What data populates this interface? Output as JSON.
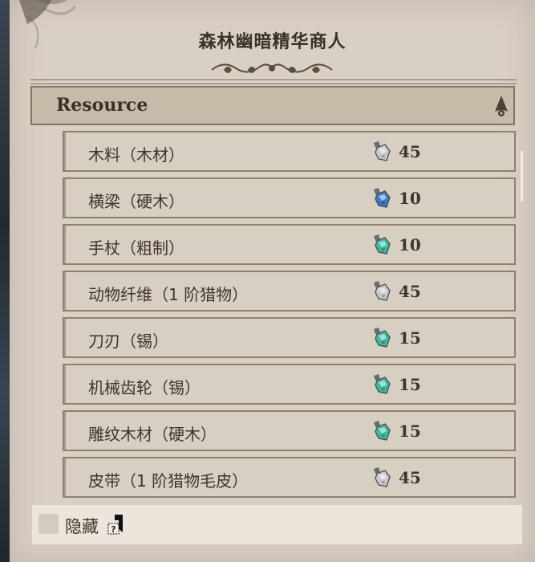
{
  "merchant": {
    "title": "森林幽暗精华商人"
  },
  "section": {
    "label": "Resource",
    "collapse_icon": "spade-arrow-icon"
  },
  "items": [
    {
      "name": "木料（木材）",
      "price": "45",
      "gem_color": "#c8c8cc",
      "gem_icon": "essence-gem-icon"
    },
    {
      "name": "横梁（硬木）",
      "price": "10",
      "gem_color": "#3b78c8",
      "gem_icon": "essence-gem-icon"
    },
    {
      "name": "手杖（粗制）",
      "price": "10",
      "gem_color": "#3fb8a0",
      "gem_icon": "essence-gem-icon"
    },
    {
      "name": "动物纤维（1 阶猎物）",
      "price": "45",
      "gem_color": "#c8c8cc",
      "gem_icon": "essence-gem-icon"
    },
    {
      "name": "刀刃（锡）",
      "price": "15",
      "gem_color": "#3fb8a0",
      "gem_icon": "essence-gem-icon"
    },
    {
      "name": "机械齿轮（锡）",
      "price": "15",
      "gem_color": "#3fb8a0",
      "gem_icon": "essence-gem-icon"
    },
    {
      "name": "雕纹木材（硬木）",
      "price": "15",
      "gem_color": "#3fb8a0",
      "gem_icon": "essence-gem-icon"
    },
    {
      "name": "皮带（1 阶猎物毛皮）",
      "price": "45",
      "gem_color": "#c8c8cc",
      "gem_icon": "essence-gem-icon"
    }
  ],
  "footer": {
    "hide_label": "隐藏",
    "help_icon": "help-cursor-icon"
  }
}
